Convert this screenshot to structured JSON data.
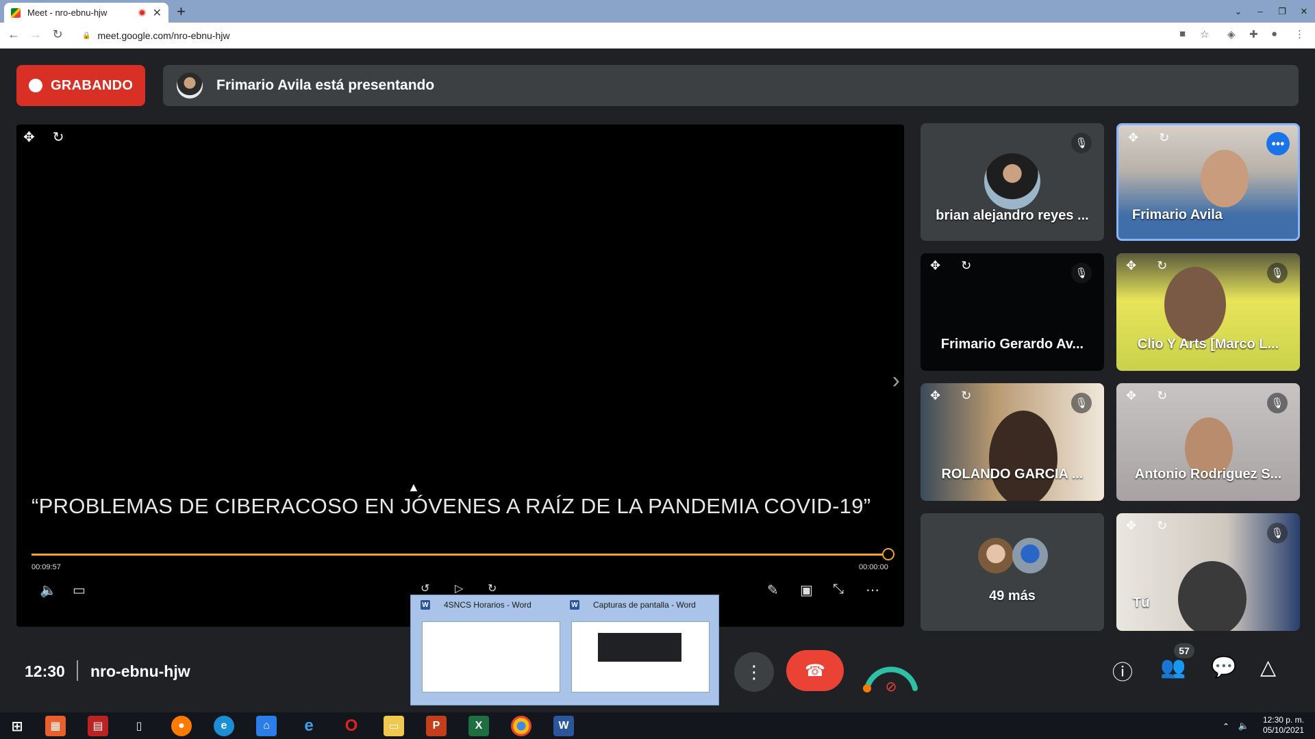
{
  "browser": {
    "tab_title": "Meet - nro-ebnu-hjw",
    "url": "meet.google.com/nro-ebnu-hjw"
  },
  "meet": {
    "recording_label": "GRABANDO",
    "presenting_text": "Frimario Avila está presentando",
    "slide_caption": "“PROBLEMAS DE CIBERACOSO EN JÓVENES A RAÍZ DE LA PANDEMIA COVID-19”",
    "time_elapsed": "00:09:57",
    "time_remaining": "00:00:00",
    "progress_fraction": 1.0,
    "participants": [
      {
        "name": "brian alejandro reyes ..."
      },
      {
        "name": "Frimario Avila"
      },
      {
        "name": "Frimario Gerardo Av..."
      },
      {
        "name": "Clio Y Arts [Marco L..."
      },
      {
        "name": "ROLANDO GARCIA ..."
      },
      {
        "name": "Antonio Rodriguez S..."
      },
      {
        "name": "49 más"
      },
      {
        "name": "Tú"
      }
    ],
    "clock": "12:30",
    "meeting_code": "nro-ebnu-hjw",
    "participant_count": "57",
    "accent_color": "#d93025",
    "progress_color": "#f3a32b"
  },
  "taskbar_preview": {
    "items": [
      {
        "title": "4SNCS Horarios - Word"
      },
      {
        "title": "Capturas de pantalla - Word"
      }
    ]
  },
  "system": {
    "time": "12:30 p. m.",
    "date": "05/10/2021"
  }
}
